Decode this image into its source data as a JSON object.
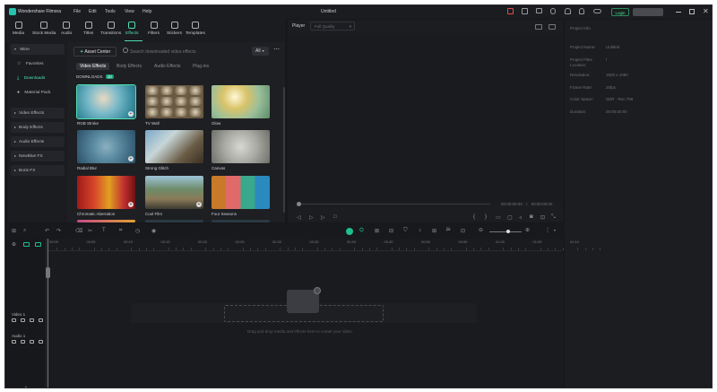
{
  "app": {
    "name": "Wondershare Filmora",
    "doc_title": "Untitled"
  },
  "menu": [
    "File",
    "Edit",
    "Tools",
    "View",
    "Help"
  ],
  "login_label": "Login",
  "toolbar": [
    {
      "label": "Media",
      "icon": "media-icon"
    },
    {
      "label": "Stock Media",
      "icon": "stock-media-icon"
    },
    {
      "label": "Audio",
      "icon": "audio-icon"
    },
    {
      "label": "Titles",
      "icon": "titles-icon"
    },
    {
      "label": "Transitions",
      "icon": "transitions-icon"
    },
    {
      "label": "Effects",
      "icon": "effects-icon",
      "active": true
    },
    {
      "label": "Filters",
      "icon": "filters-icon"
    },
    {
      "label": "Stickers",
      "icon": "stickers-icon"
    },
    {
      "label": "Templates",
      "icon": "templates-icon"
    }
  ],
  "sidebar": {
    "mine": "Mine",
    "sub": [
      "Favorites",
      "Downloads",
      "Material Pack"
    ],
    "groups": [
      "Video Effects",
      "Body Effects",
      "Audio Effects",
      "NewBlue FX",
      "Boris FX"
    ]
  },
  "effects": {
    "asset_center": "Asset Center",
    "search_placeholder": "Search downloaded video effects",
    "filter": "All",
    "tabs": [
      "Video Effects",
      "Body Effects",
      "Audio Effects",
      "Plug-ins"
    ],
    "downloads_label": "DOWNLOADS",
    "downloads_count": "10",
    "items": [
      "RGB Stroke",
      "TV Wall",
      "Glow",
      "Radial Blur",
      "Strong Glitch",
      "Canvas",
      "Chromatic Aberration",
      "Cool Film",
      "Four Seasons"
    ]
  },
  "player": {
    "label": "Player",
    "quality": "Full Quality",
    "time_current": "00:00:00:00",
    "time_sep": "/",
    "time_total": "00:00:00:00"
  },
  "project_info": {
    "title": "Project Info",
    "rows": [
      {
        "k": "Project Name:",
        "v": "Untitled"
      },
      {
        "k": "Project Files Location:",
        "v": "/"
      },
      {
        "k": "Resolution:",
        "v": "1920 x 1080"
      },
      {
        "k": "Frame Rate:",
        "v": "25fps"
      },
      {
        "k": "Color Space:",
        "v": "SDR - Rec.709"
      },
      {
        "k": "Duration:",
        "v": "00:00:00:00"
      }
    ]
  },
  "timeline": {
    "ticks": [
      "00:00",
      "00:05",
      "00:10",
      "00:15",
      "00:20",
      "00:25",
      "00:30",
      "00:35",
      "00:40",
      "00:45",
      "00:50",
      "00:55",
      "01:00",
      "01:05",
      "01:10"
    ],
    "tracks": [
      {
        "label": "Video 1",
        "icon": "video-track-icon"
      },
      {
        "label": "Audio 1",
        "icon": "audio-track-icon"
      }
    ],
    "drop_hint": "Drag and drop media and effects here to create your video."
  }
}
